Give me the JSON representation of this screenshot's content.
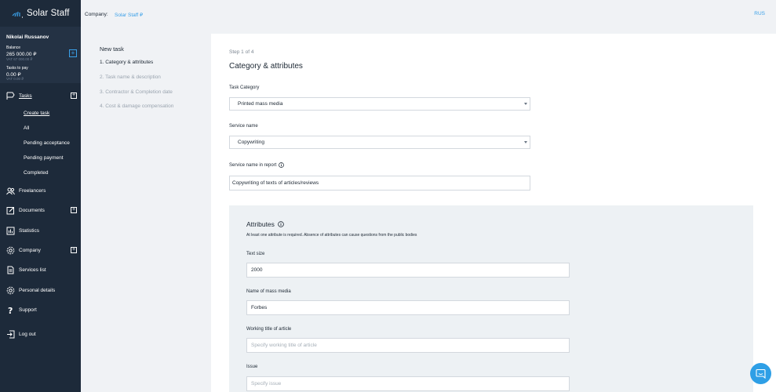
{
  "app": {
    "logo_text": "Solar Staff"
  },
  "user": {
    "name": "Nikolai Russanov",
    "balance_label": "Balance",
    "balance_value": "265 000.00 ₽",
    "balance_vat": "VAT 67 000.00 ₽",
    "to_pay_label": "Tasks to pay",
    "to_pay_value": "0.00 ₽",
    "to_pay_vat": "VAT 0.00 ₽"
  },
  "nav": {
    "tasks": "Tasks",
    "tasks_sub": [
      "Create task",
      "All",
      "Pending acceptance",
      "Pending payment",
      "Completed"
    ],
    "freelancers": "Freelancers",
    "documents": "Documents",
    "statistics": "Statistics",
    "company": "Company",
    "services_list": "Services list",
    "personal_details": "Personal details",
    "support": "Support",
    "log_out": "Log out"
  },
  "topbar": {
    "company_label": "Company:",
    "company_value": "Solar Staff ₽",
    "lang": "RUS"
  },
  "steps": {
    "title": "New task",
    "items": [
      "1. Category & attributes",
      "2. Task name & description",
      "3. Contractor & Completion date",
      "4. Cost & damage compensation"
    ]
  },
  "form": {
    "step_count": "Step 1 of 4",
    "title": "Category & attributes",
    "task_category_label": "Task Category",
    "task_category_value": "Printed mass media",
    "service_name_label": "Service name",
    "service_name_value": "Copywriting",
    "report_label": "Service name in report",
    "report_value": "Copywriting of texts of articles/reviews"
  },
  "attributes": {
    "title": "Attributes",
    "note": "At least one attribute is required. Absence of attributes can cause questions from the public bodies",
    "text_size_label": "Text size",
    "text_size_value": "2000",
    "media_label": "Name of mass media",
    "media_value": "Forbes",
    "working_title_label": "Working title of article",
    "working_title_placeholder": "Specify working title of article",
    "issue_label": "Issue",
    "issue_placeholder": "Specify issue"
  },
  "colors": {
    "sidebar": "#1d2a3a",
    "accent": "#3aa0e8",
    "chat": "#2e9fe6",
    "attrs_bg": "#edf1f4"
  }
}
